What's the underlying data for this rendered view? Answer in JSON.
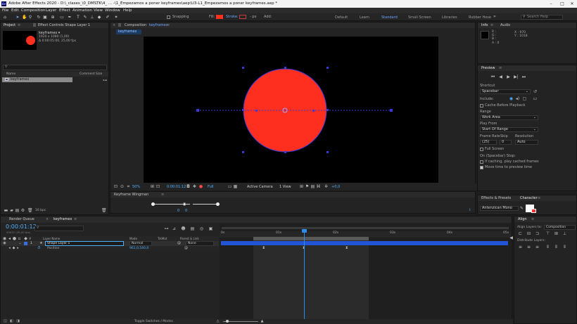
{
  "window": {
    "title": "Adobe After Effects 2020 - D:\\_clases_\\0_DMSTK\\4_ ... -\\1_Empezamos a poner keyframes\\aep\\U3-L1_Empezamos a poner keyframes.aep *"
  },
  "menu": [
    "File",
    "Edit",
    "Composition",
    "Layer",
    "Effect",
    "Animation",
    "View",
    "Window",
    "Help"
  ],
  "toolbar": {
    "snapping_label": "Snapping",
    "fill_label": "Fill:",
    "stroke_label": "Stroke:",
    "stroke_width": "- px",
    "add_label": "Add:",
    "workspaces": [
      "Default",
      "Learn",
      "Standard",
      "Small Screen",
      "Libraries",
      "Rubber Hose"
    ],
    "active_workspace": "Standard",
    "search_placeholder": "Search Help"
  },
  "project_panel": {
    "tab_project": "Project",
    "tab_effect_controls": "Effect Controls Shape Layer 1",
    "comp_name": "keyframes ▾",
    "comp_size": "1920 x 1080 (1,00)",
    "comp_duration": "Δ 0:00:05:00, 25,00 fps",
    "search_placeholder": "",
    "col_name": "Name",
    "col_comment": "Comment",
    "col_size": "Size",
    "items": [
      "keyframes"
    ],
    "bpc": "16 bpc"
  },
  "composition_panel": {
    "tab_label": "Composition",
    "comp_name": "keyframes",
    "breadcrumb": "keyframes",
    "zoom": "50%",
    "timecode": "0:00:01:12",
    "resolution": "Full",
    "camera": "Active Camera",
    "views": "1 View",
    "exposure": "+0,0"
  },
  "wingman_panel": {
    "title": "Keyframe Wingman",
    "left_value": "0",
    "right_value": "0"
  },
  "info_panel": {
    "tab_info": "Info",
    "tab_audio": "Audio",
    "r": "R :",
    "g": "G :",
    "b": "B :",
    "a": "A : 0",
    "x": "X : 970",
    "y": "Y : 1018"
  },
  "preview_panel": {
    "title": "Preview",
    "shortcut_label": "Shortcut",
    "shortcut_value": "Spacebar",
    "include_label": "Include:",
    "cache_before_playback": "Cache Before Playback",
    "range_label": "Range",
    "range_value": "Work Area",
    "play_from_label": "Play From",
    "play_from_value": "Start Of Range",
    "frame_rate_label": "Frame Rate",
    "skip_label": "Skip",
    "resolution_label": "Resolution",
    "frame_rate_value": "(25)",
    "skip_value": "0",
    "resolution_value": "Auto",
    "full_screen": "Full Screen",
    "on_stop_label": "On (Spacebar) Stop:",
    "if_caching": "If caching, play cached frames",
    "move_time": "Move time to preview time"
  },
  "effects_panel": {
    "tab_effects": "Effects & Presets",
    "tab_character": "Character",
    "font_value": "Antenzican Mono"
  },
  "align_panel": {
    "title": "Align",
    "align_layers_to": "Align Layers to:",
    "align_target": "Composition",
    "distribute_layers": "Distribute Layers:"
  },
  "timeline": {
    "tab_render_queue": "Render Queue",
    "tab_comp": "keyframes",
    "timecode": "0:00:01:12",
    "sub_timecode": "00037 (25,00 fps)",
    "search_placeholder": "",
    "col_layer_name": "Layer Name",
    "col_mode": "Mode",
    "col_trkmat": "TrkMat",
    "col_parent": "Parent & Link",
    "layers": [
      {
        "num": "1",
        "name": "Shape Layer 1",
        "mode": "Normal",
        "parent": "None"
      }
    ],
    "property_name": "Position",
    "property_value": "961,0,540,0",
    "ruler_labels": [
      "0s",
      "01s",
      "02s",
      "03s",
      "04s",
      "05s"
    ],
    "toggle_label": "Toggle Switches / Modes"
  },
  "colors": {
    "accent": "#2d8ceb",
    "circle_fill": "#ff2f1f",
    "layer_bar": "#2255d6",
    "workarea": "#3a3a3a"
  }
}
